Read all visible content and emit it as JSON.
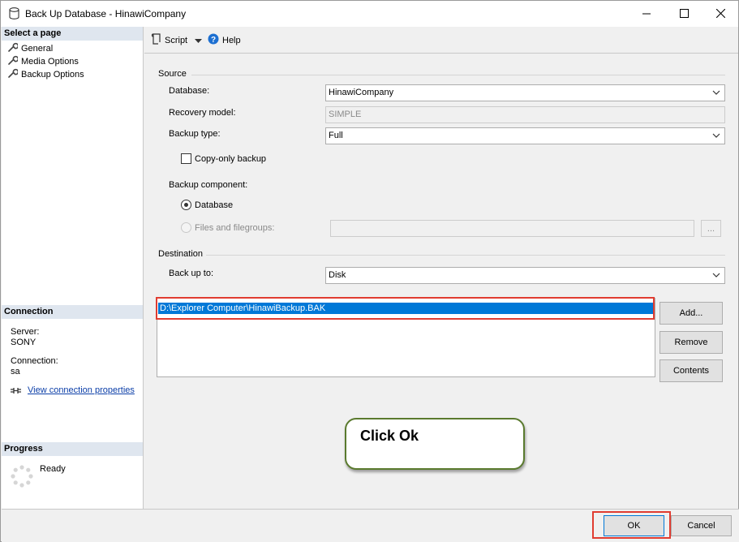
{
  "window": {
    "title": "Back Up Database - HinawiCompany",
    "controls": {
      "minimize": "—",
      "maximize": "☐",
      "close": "✕"
    }
  },
  "sidebar": {
    "select_page_header": "Select a page",
    "pages": [
      {
        "label": "General"
      },
      {
        "label": "Media Options"
      },
      {
        "label": "Backup Options"
      }
    ],
    "connection_header": "Connection",
    "server_label": "Server:",
    "server_value": "SONY",
    "connection_label": "Connection:",
    "connection_value": "sa",
    "view_connection_link": "View connection properties",
    "progress_header": "Progress",
    "progress_status": "Ready"
  },
  "toolbar": {
    "script_label": "Script",
    "help_label": "Help"
  },
  "form": {
    "source_group": "Source",
    "database_label": "Database:",
    "database_value": "HinawiCompany",
    "recovery_model_label": "Recovery model:",
    "recovery_model_value": "SIMPLE",
    "backup_type_label": "Backup type:",
    "backup_type_value": "Full",
    "copy_only_label": "Copy-only backup",
    "copy_only_checked": false,
    "backup_component_label": "Backup component:",
    "component_database_label": "Database",
    "component_files_label": "Files and filegroups:",
    "files_browse_label": "...",
    "destination_group": "Destination",
    "back_up_to_label": "Back up to:",
    "back_up_to_value": "Disk",
    "destinations": [
      "D:\\Explorer Computer\\HinawiBackup.BAK"
    ],
    "add_button": "Add...",
    "remove_button": "Remove",
    "contents_button": "Contents"
  },
  "callout": {
    "text": "Click Ok"
  },
  "footer": {
    "ok_button": "OK",
    "cancel_button": "Cancel"
  },
  "colors": {
    "accent_selection": "#0078d7",
    "highlight_box": "#e03c31",
    "callout_border": "#5a7a2e",
    "section_header_bg": "#dfe6ef"
  }
}
